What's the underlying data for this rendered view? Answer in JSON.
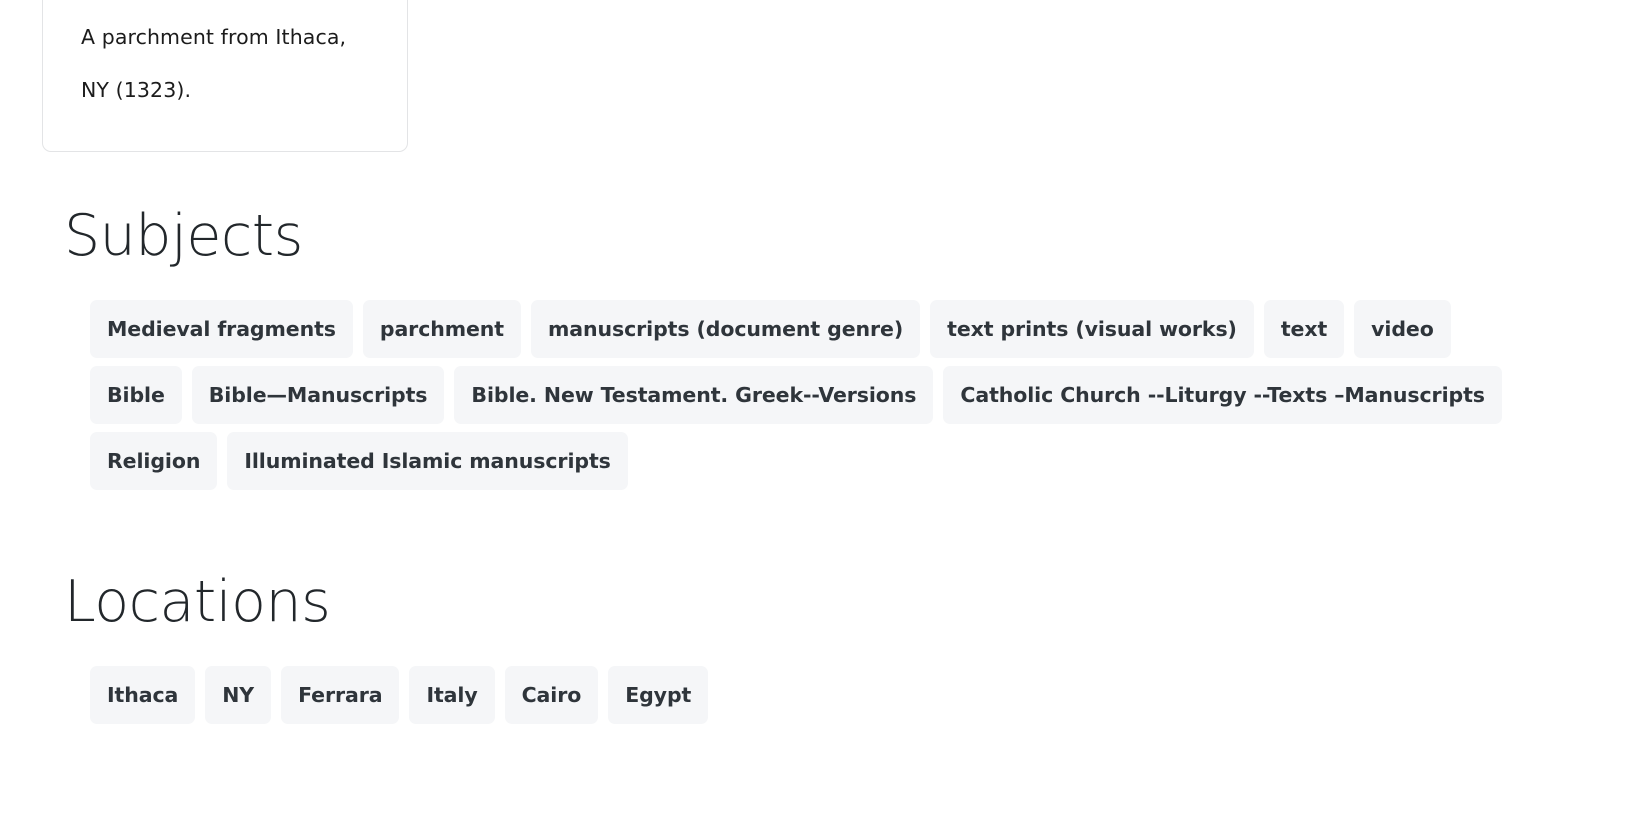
{
  "description_card": {
    "text": "A parchment from Ithaca,\nNY (1323)."
  },
  "subjects": {
    "heading": "Subjects",
    "tags": [
      "Medieval fragments",
      "parchment",
      "manuscripts (document genre)",
      "text prints (visual works)",
      "text",
      "video",
      "Bible",
      "Bible—Manuscripts",
      "Bible. New Testament. Greek--Versions",
      "Catholic Church --Liturgy --Texts –Manuscripts",
      "Religion",
      "Illuminated Islamic manuscripts"
    ]
  },
  "locations": {
    "heading": "Locations",
    "tags": [
      "Ithaca",
      "NY",
      "Ferrara",
      "Italy",
      "Cairo",
      "Egypt"
    ]
  },
  "theme": {
    "page_background": "#ffffff",
    "tag_background": "#f5f6f8",
    "tag_text": "#2f353b",
    "heading_text": "#22272b",
    "card_border": "#e3e4e6",
    "body_text": "#1c1c1c"
  }
}
